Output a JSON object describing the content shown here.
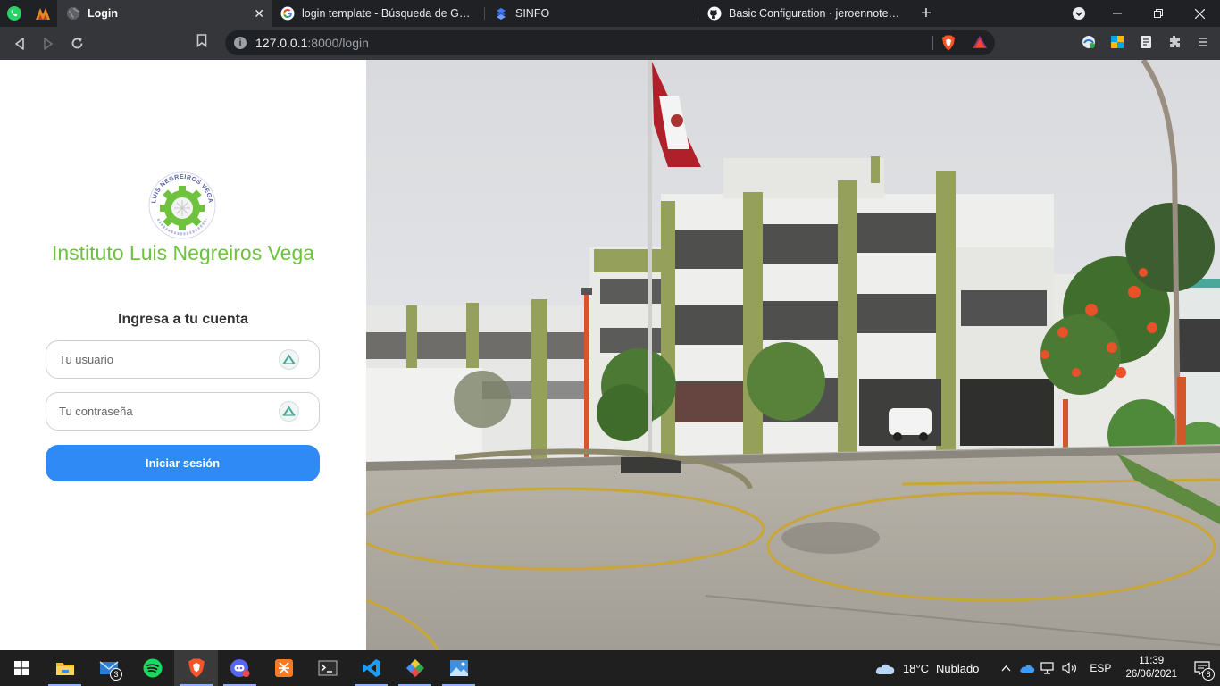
{
  "browser": {
    "tabs": [
      {
        "title": "Login",
        "active": true
      },
      {
        "title": "login template - Búsqueda de Google",
        "active": false
      },
      {
        "title": "SINFO",
        "active": false
      },
      {
        "title": "Basic Configuration · jeroennoten/Lara",
        "active": false
      }
    ],
    "close_glyph": "✕",
    "new_tab_glyph": "+",
    "url_host": "127.0.0.1",
    "url_path": ":8000/login",
    "icons": [
      "whatsapp-icon",
      "brave-rewards-icon",
      "globe-icon",
      "google-icon",
      "sinfo-icon",
      "github-icon",
      "back-icon",
      "forward-icon",
      "reload-icon",
      "bookmark-icon",
      "info-icon",
      "brave-shields-icon",
      "extensions-icon",
      "menu-icon"
    ]
  },
  "login": {
    "institute_name": "Instituto Luis Negreiros Vega",
    "logo_text_top": "LUIS NEGREIROS VEGA",
    "form_title": "Ingresa a tu cuenta",
    "username_placeholder": "Tu usuario",
    "password_placeholder": "Tu contraseña",
    "submit_label": "Iniciar sesión",
    "accent_green": "#6ec23e",
    "button_blue": "#2f8af5"
  },
  "taskbar": {
    "mail_badge": "3",
    "weather_temp": "18°C",
    "weather_desc": "Nublado",
    "language": "ESP",
    "time": "11:39",
    "date": "26/06/2021",
    "notification_count": "8"
  }
}
